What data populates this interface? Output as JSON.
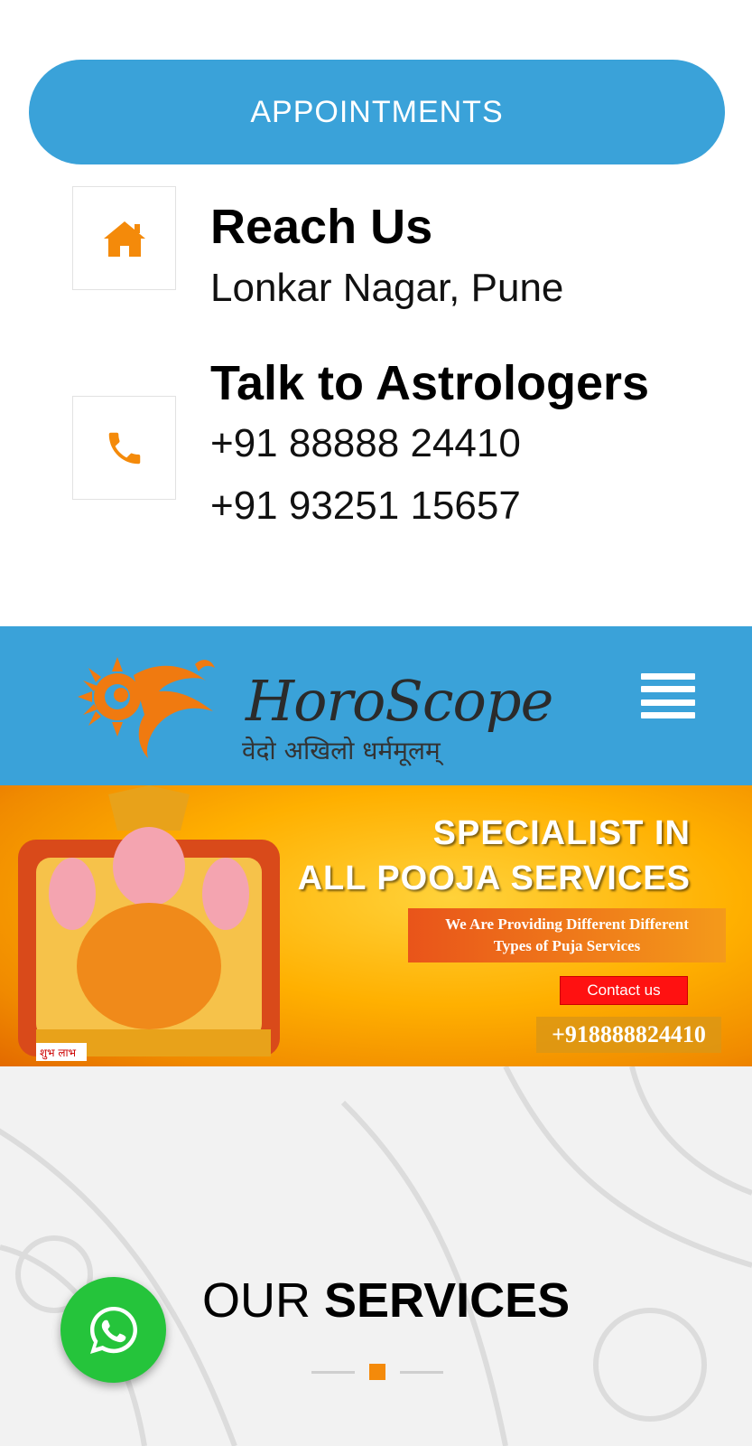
{
  "appointments": {
    "label": "APPOINTMENTS"
  },
  "reach": {
    "title": "Reach Us",
    "address": "Lonkar Nagar, Pune",
    "icon": "home-icon"
  },
  "talk": {
    "title": "Talk to Astrologers",
    "phones": [
      "+91 88888 24410",
      "+91 93251 15657"
    ],
    "icon": "phone-icon"
  },
  "header": {
    "logo_text": "HoroScope",
    "logo_tagline": "वेदो अखिलो धर्ममूलम्",
    "menu_icon": "hamburger-menu-icon"
  },
  "banner": {
    "heading_line1": "SPECIALIST IN",
    "heading_line2": "ALL POOJA SERVICES",
    "sub_line1": "We Are Providing Different Different",
    "sub_line2": "Types of Puja  Services",
    "contact_label": "Contact us",
    "phone": "+918888824410",
    "shubh": "शुभ लाभ"
  },
  "services": {
    "title_light": "OUR",
    "title_bold": "SERVICES"
  },
  "whatsapp": {
    "icon": "whatsapp-icon"
  },
  "colors": {
    "accent_blue": "#3aa2d9",
    "icon_orange": "#f48a0a",
    "whatsapp_green": "#25c43b"
  }
}
